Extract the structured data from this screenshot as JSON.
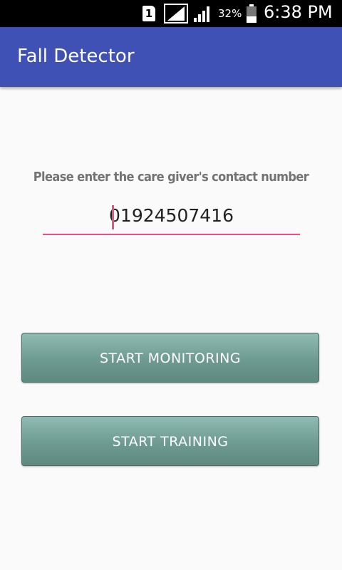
{
  "status_bar": {
    "sim_slot": "1",
    "battery_percent": "32%",
    "time": "6:38 PM"
  },
  "app_bar": {
    "title": "Fall Detector",
    "color": "#3f51b5"
  },
  "form": {
    "prompt": "Please enter the care giver's contact number",
    "phone_number": "01924507416",
    "accent_color": "#ee4d86"
  },
  "actions": {
    "start_monitoring": "START MONITORING",
    "start_training": "START TRAINING"
  }
}
